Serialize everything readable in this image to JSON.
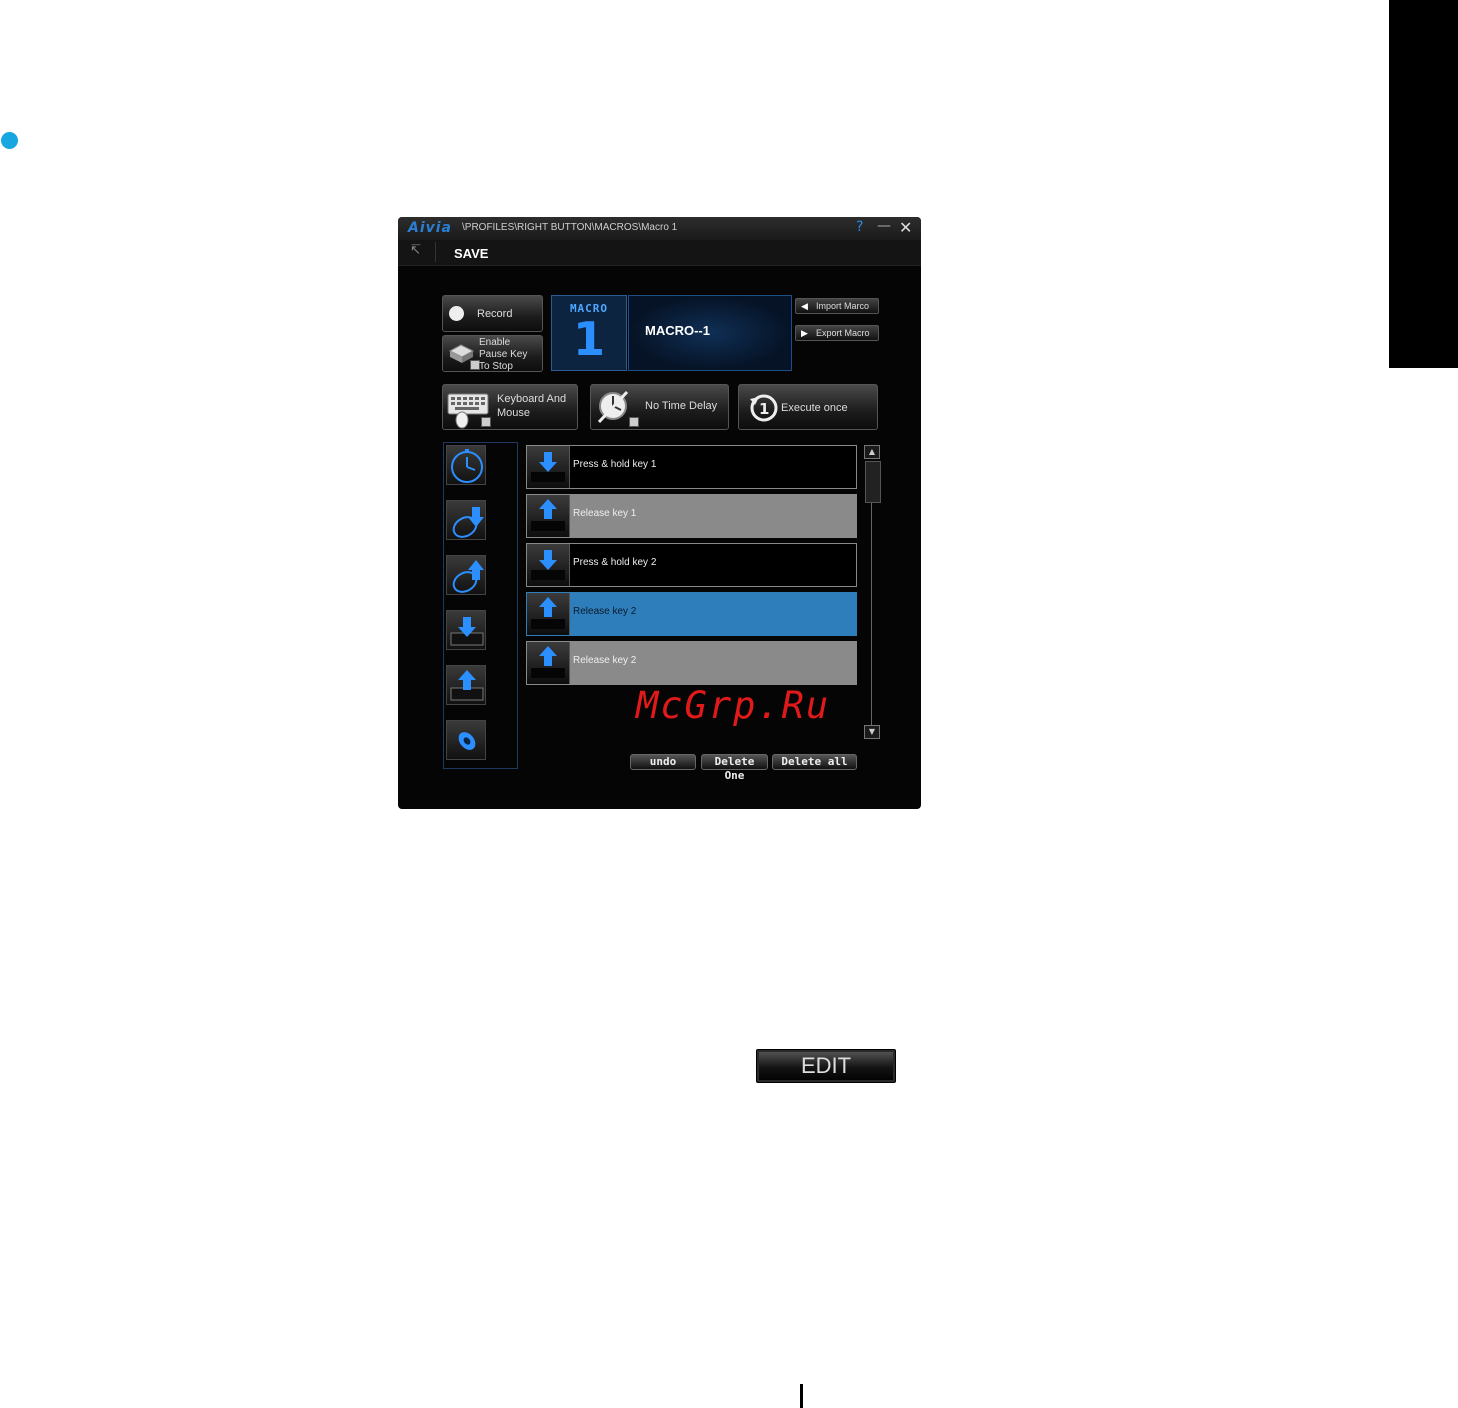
{
  "page": {
    "watermark": "McGrp.Ru",
    "edit_button": "EDIT"
  },
  "window": {
    "logo": "Aivia",
    "path": "\\PROFILES\\RIGHT BUTTON\\MACROS\\Macro 1",
    "help": "?",
    "minimize": "—",
    "close": "✕",
    "back": "↸",
    "save": "SAVE"
  },
  "controls": {
    "record": "Record",
    "enable_pause_line1": "Enable",
    "enable_pause_line2": "Pause Key",
    "enable_pause_line3": "To Stop",
    "macro_tile_word": "MACRO",
    "macro_tile_number": "1",
    "macro_name": "MACRO--1",
    "import": "Import Marco",
    "export": "Export Macro",
    "keyboard_mouse_line1": "Keyboard And",
    "keyboard_mouse_line2": "Mouse",
    "no_time_delay": "No Time Delay",
    "execute_once": "Execute once"
  },
  "macro_steps": [
    {
      "label": "Press & hold key 1",
      "direction": "down",
      "state": "normal"
    },
    {
      "label": "Release key 1",
      "direction": "up",
      "state": "gray"
    },
    {
      "label": "Press & hold key 2",
      "direction": "down",
      "state": "normal"
    },
    {
      "label": "Release key 2",
      "direction": "up",
      "state": "selected"
    },
    {
      "label": "Release key 2",
      "direction": "up",
      "state": "gray"
    }
  ],
  "bottom_buttons": {
    "undo": "undo",
    "delete_one": "Delete One",
    "delete_all": "Delete all"
  },
  "colors": {
    "accent_blue": "#2b8fff",
    "selected_row": "#2f7ebc",
    "gray_row": "#8a8a8a",
    "bullet": "#17a6e0"
  }
}
